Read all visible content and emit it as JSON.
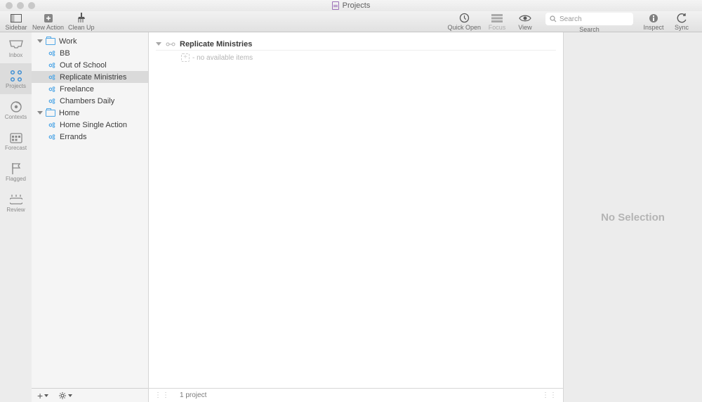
{
  "window": {
    "title": "Projects"
  },
  "toolbar": {
    "sidebar": "Sidebar",
    "new_action": "New Action",
    "clean_up": "Clean Up",
    "quick_open": "Quick Open",
    "focus": "Focus",
    "view": "View",
    "search_placeholder": "Search",
    "search_caption": "Search",
    "inspect": "Inspect",
    "sync": "Sync"
  },
  "perspectives": [
    {
      "id": "inbox",
      "label": "Inbox"
    },
    {
      "id": "projects",
      "label": "Projects"
    },
    {
      "id": "contexts",
      "label": "Contexts"
    },
    {
      "id": "forecast",
      "label": "Forecast"
    },
    {
      "id": "flagged",
      "label": "Flagged"
    },
    {
      "id": "review",
      "label": "Review"
    }
  ],
  "outline": {
    "folders": [
      {
        "name": "Work",
        "projects": [
          "BB",
          "Out of School",
          "Replicate Ministries",
          "Freelance",
          "Chambers Daily"
        ]
      },
      {
        "name": "Home",
        "projects": [
          "Home Single Action",
          "Errands"
        ]
      }
    ],
    "selected_project": "Replicate Ministries"
  },
  "main": {
    "project_title": "Replicate Ministries",
    "empty_text": "- no available items",
    "status_text": "1 project"
  },
  "inspector": {
    "no_selection": "No Selection"
  }
}
